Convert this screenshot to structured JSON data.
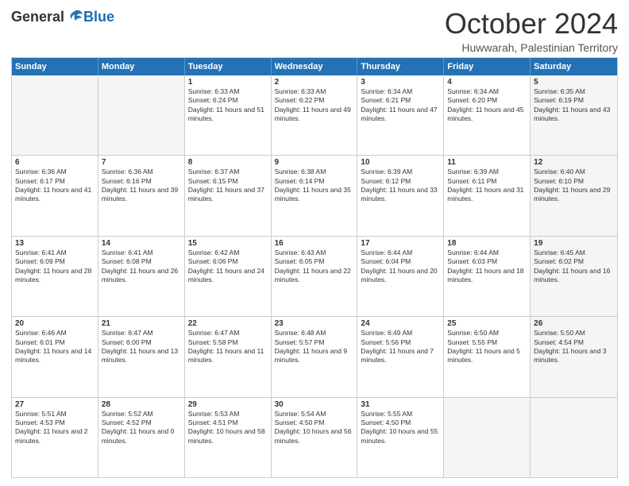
{
  "header": {
    "logo_general": "General",
    "logo_blue": "Blue",
    "month_title": "October 2024",
    "location": "Huwwarah, Palestinian Territory"
  },
  "days_of_week": [
    "Sunday",
    "Monday",
    "Tuesday",
    "Wednesday",
    "Thursday",
    "Friday",
    "Saturday"
  ],
  "weeks": [
    [
      {
        "day": "",
        "sunrise": "",
        "sunset": "",
        "daylight": "",
        "empty": true
      },
      {
        "day": "",
        "sunrise": "",
        "sunset": "",
        "daylight": "",
        "empty": true
      },
      {
        "day": "1",
        "sunrise": "Sunrise: 6:33 AM",
        "sunset": "Sunset: 6:24 PM",
        "daylight": "Daylight: 11 hours and 51 minutes.",
        "empty": false
      },
      {
        "day": "2",
        "sunrise": "Sunrise: 6:33 AM",
        "sunset": "Sunset: 6:22 PM",
        "daylight": "Daylight: 11 hours and 49 minutes.",
        "empty": false
      },
      {
        "day": "3",
        "sunrise": "Sunrise: 6:34 AM",
        "sunset": "Sunset: 6:21 PM",
        "daylight": "Daylight: 11 hours and 47 minutes.",
        "empty": false
      },
      {
        "day": "4",
        "sunrise": "Sunrise: 6:34 AM",
        "sunset": "Sunset: 6:20 PM",
        "daylight": "Daylight: 11 hours and 45 minutes.",
        "empty": false
      },
      {
        "day": "5",
        "sunrise": "Sunrise: 6:35 AM",
        "sunset": "Sunset: 6:19 PM",
        "daylight": "Daylight: 11 hours and 43 minutes.",
        "empty": false
      }
    ],
    [
      {
        "day": "6",
        "sunrise": "Sunrise: 6:36 AM",
        "sunset": "Sunset: 6:17 PM",
        "daylight": "Daylight: 11 hours and 41 minutes.",
        "empty": false
      },
      {
        "day": "7",
        "sunrise": "Sunrise: 6:36 AM",
        "sunset": "Sunset: 6:16 PM",
        "daylight": "Daylight: 11 hours and 39 minutes.",
        "empty": false
      },
      {
        "day": "8",
        "sunrise": "Sunrise: 6:37 AM",
        "sunset": "Sunset: 6:15 PM",
        "daylight": "Daylight: 11 hours and 37 minutes.",
        "empty": false
      },
      {
        "day": "9",
        "sunrise": "Sunrise: 6:38 AM",
        "sunset": "Sunset: 6:14 PM",
        "daylight": "Daylight: 11 hours and 35 minutes.",
        "empty": false
      },
      {
        "day": "10",
        "sunrise": "Sunrise: 6:39 AM",
        "sunset": "Sunset: 6:12 PM",
        "daylight": "Daylight: 11 hours and 33 minutes.",
        "empty": false
      },
      {
        "day": "11",
        "sunrise": "Sunrise: 6:39 AM",
        "sunset": "Sunset: 6:11 PM",
        "daylight": "Daylight: 11 hours and 31 minutes.",
        "empty": false
      },
      {
        "day": "12",
        "sunrise": "Sunrise: 6:40 AM",
        "sunset": "Sunset: 6:10 PM",
        "daylight": "Daylight: 11 hours and 29 minutes.",
        "empty": false
      }
    ],
    [
      {
        "day": "13",
        "sunrise": "Sunrise: 6:41 AM",
        "sunset": "Sunset: 6:09 PM",
        "daylight": "Daylight: 11 hours and 28 minutes.",
        "empty": false
      },
      {
        "day": "14",
        "sunrise": "Sunrise: 6:41 AM",
        "sunset": "Sunset: 6:08 PM",
        "daylight": "Daylight: 11 hours and 26 minutes.",
        "empty": false
      },
      {
        "day": "15",
        "sunrise": "Sunrise: 6:42 AM",
        "sunset": "Sunset: 6:06 PM",
        "daylight": "Daylight: 11 hours and 24 minutes.",
        "empty": false
      },
      {
        "day": "16",
        "sunrise": "Sunrise: 6:43 AM",
        "sunset": "Sunset: 6:05 PM",
        "daylight": "Daylight: 11 hours and 22 minutes.",
        "empty": false
      },
      {
        "day": "17",
        "sunrise": "Sunrise: 6:44 AM",
        "sunset": "Sunset: 6:04 PM",
        "daylight": "Daylight: 11 hours and 20 minutes.",
        "empty": false
      },
      {
        "day": "18",
        "sunrise": "Sunrise: 6:44 AM",
        "sunset": "Sunset: 6:03 PM",
        "daylight": "Daylight: 11 hours and 18 minutes.",
        "empty": false
      },
      {
        "day": "19",
        "sunrise": "Sunrise: 6:45 AM",
        "sunset": "Sunset: 6:02 PM",
        "daylight": "Daylight: 11 hours and 16 minutes.",
        "empty": false
      }
    ],
    [
      {
        "day": "20",
        "sunrise": "Sunrise: 6:46 AM",
        "sunset": "Sunset: 6:01 PM",
        "daylight": "Daylight: 11 hours and 14 minutes.",
        "empty": false
      },
      {
        "day": "21",
        "sunrise": "Sunrise: 6:47 AM",
        "sunset": "Sunset: 6:00 PM",
        "daylight": "Daylight: 11 hours and 13 minutes.",
        "empty": false
      },
      {
        "day": "22",
        "sunrise": "Sunrise: 6:47 AM",
        "sunset": "Sunset: 5:58 PM",
        "daylight": "Daylight: 11 hours and 11 minutes.",
        "empty": false
      },
      {
        "day": "23",
        "sunrise": "Sunrise: 6:48 AM",
        "sunset": "Sunset: 5:57 PM",
        "daylight": "Daylight: 11 hours and 9 minutes.",
        "empty": false
      },
      {
        "day": "24",
        "sunrise": "Sunrise: 6:49 AM",
        "sunset": "Sunset: 5:56 PM",
        "daylight": "Daylight: 11 hours and 7 minutes.",
        "empty": false
      },
      {
        "day": "25",
        "sunrise": "Sunrise: 6:50 AM",
        "sunset": "Sunset: 5:55 PM",
        "daylight": "Daylight: 11 hours and 5 minutes.",
        "empty": false
      },
      {
        "day": "26",
        "sunrise": "Sunrise: 5:50 AM",
        "sunset": "Sunset: 4:54 PM",
        "daylight": "Daylight: 11 hours and 3 minutes.",
        "empty": false
      }
    ],
    [
      {
        "day": "27",
        "sunrise": "Sunrise: 5:51 AM",
        "sunset": "Sunset: 4:53 PM",
        "daylight": "Daylight: 11 hours and 2 minutes.",
        "empty": false
      },
      {
        "day": "28",
        "sunrise": "Sunrise: 5:52 AM",
        "sunset": "Sunset: 4:52 PM",
        "daylight": "Daylight: 11 hours and 0 minutes.",
        "empty": false
      },
      {
        "day": "29",
        "sunrise": "Sunrise: 5:53 AM",
        "sunset": "Sunset: 4:51 PM",
        "daylight": "Daylight: 10 hours and 58 minutes.",
        "empty": false
      },
      {
        "day": "30",
        "sunrise": "Sunrise: 5:54 AM",
        "sunset": "Sunset: 4:50 PM",
        "daylight": "Daylight: 10 hours and 56 minutes.",
        "empty": false
      },
      {
        "day": "31",
        "sunrise": "Sunrise: 5:55 AM",
        "sunset": "Sunset: 4:50 PM",
        "daylight": "Daylight: 10 hours and 55 minutes.",
        "empty": false
      },
      {
        "day": "",
        "sunrise": "",
        "sunset": "",
        "daylight": "",
        "empty": true
      },
      {
        "day": "",
        "sunrise": "",
        "sunset": "",
        "daylight": "",
        "empty": true
      }
    ]
  ]
}
